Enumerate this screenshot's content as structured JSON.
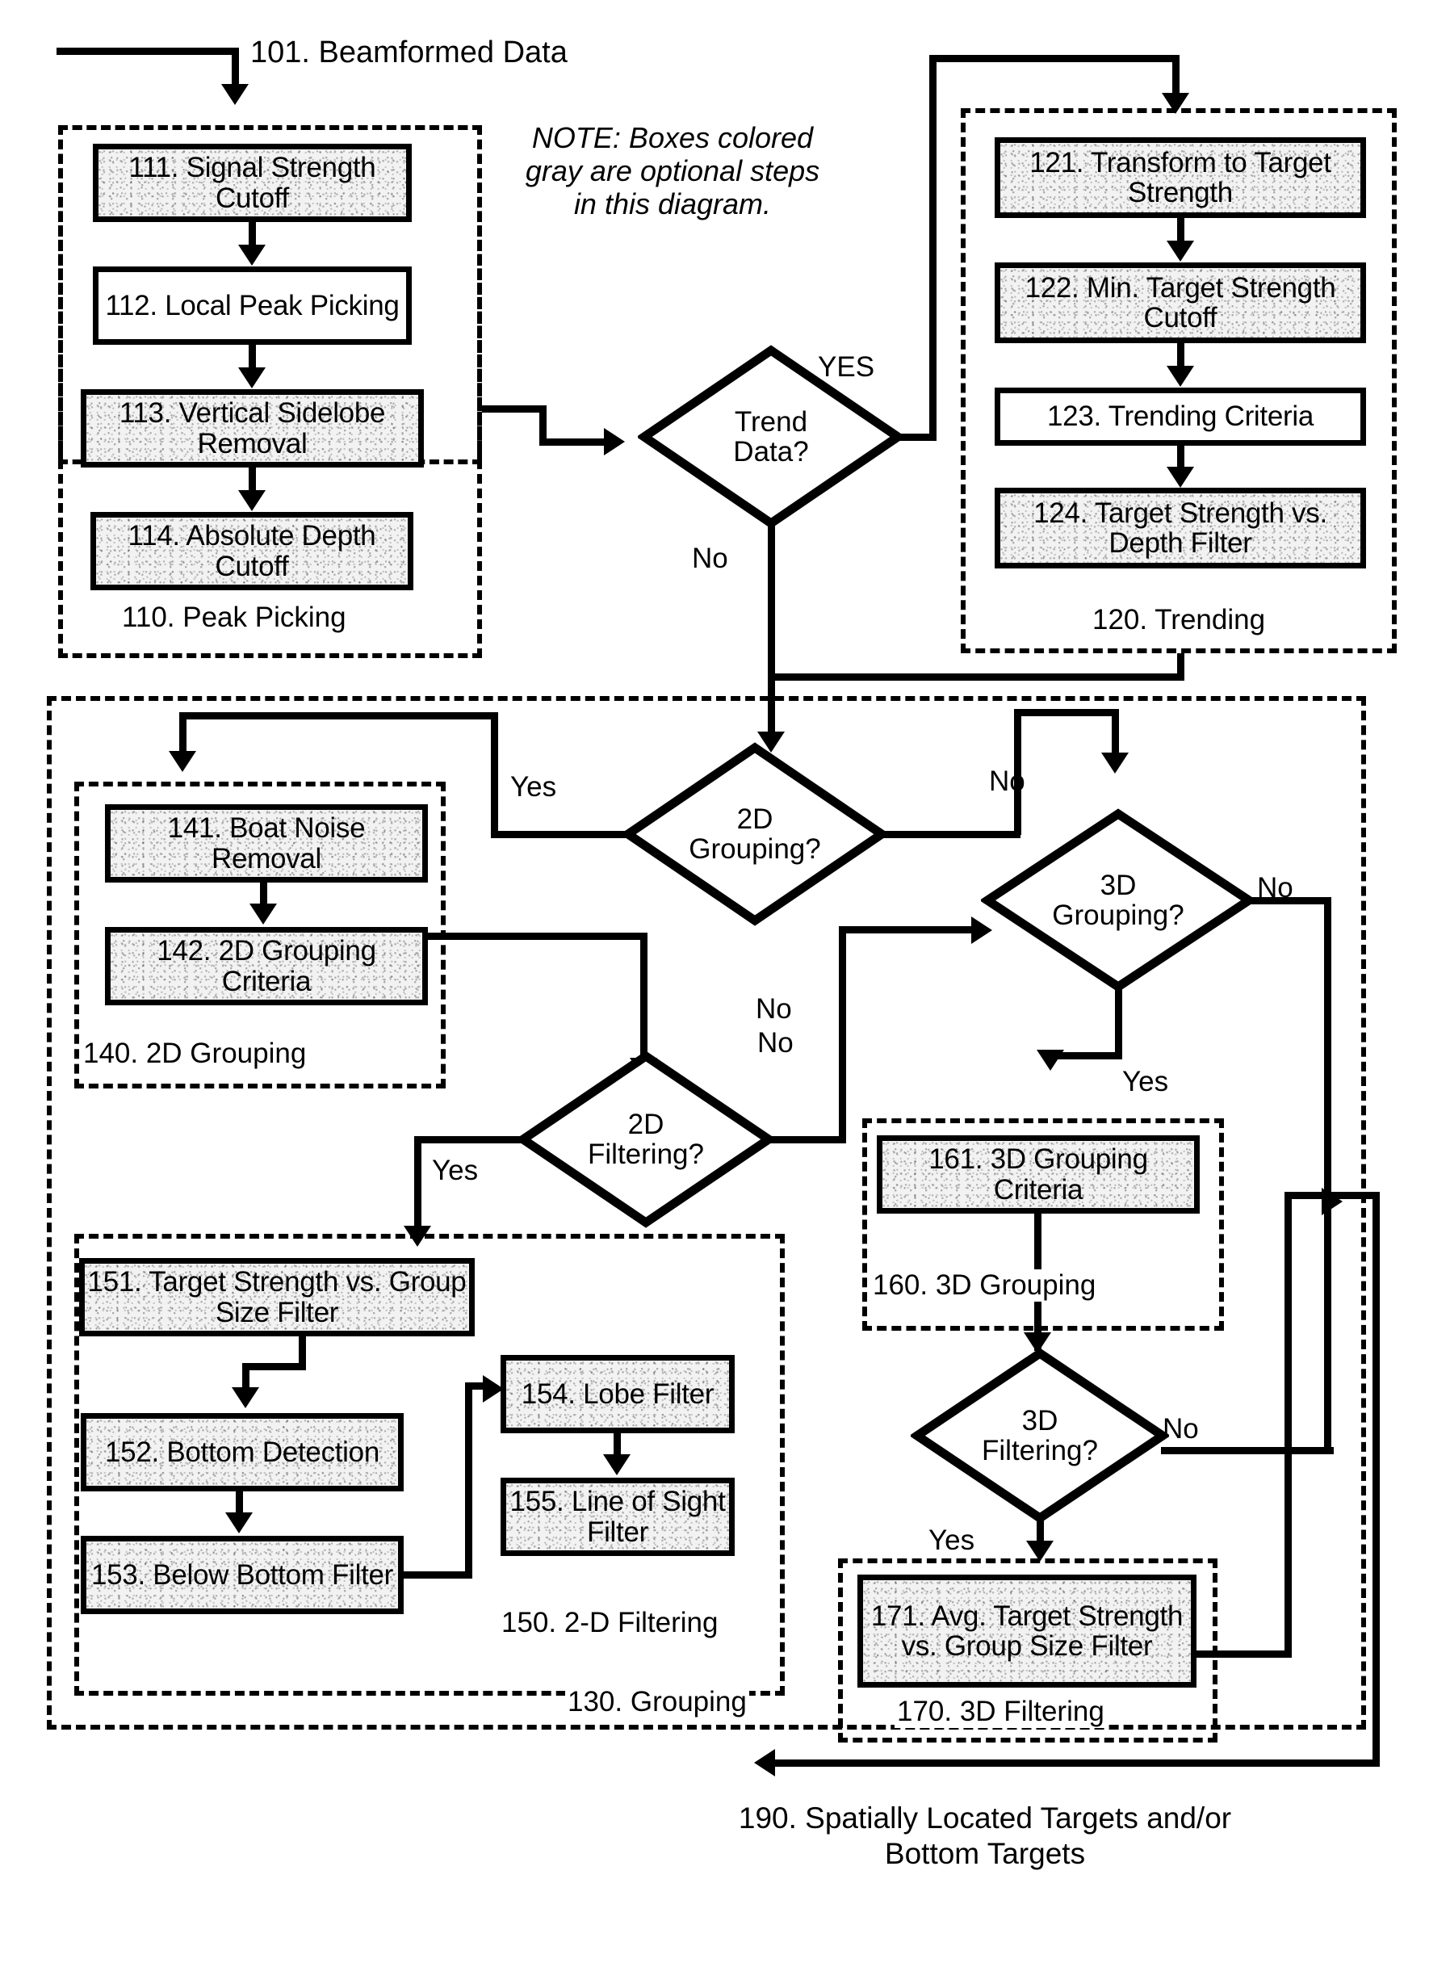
{
  "diagram": {
    "title_input": "101. Beamformed Data",
    "note": "NOTE: Boxes colored gray are optional steps in this diagram.",
    "output": "190. Spatially Located Targets and/or Bottom Targets"
  },
  "groups": {
    "peak_picking": "110. Peak Picking",
    "trending": "120. Trending",
    "grouping": "130. Grouping",
    "grouping_2d": "140. 2D Grouping",
    "filtering_2d": "150. 2-D Filtering",
    "grouping_3d": "160. 3D Grouping",
    "filtering_3d": "170. 3D Filtering"
  },
  "boxes": {
    "b111": "111. Signal Strength Cutoff",
    "b112": "112. Local Peak Picking",
    "b113": "113. Vertical Sidelobe Removal",
    "b114": "114. Absolute Depth Cutoff",
    "b121": "121. Transform to Target Strength",
    "b122": "122. Min. Target Strength Cutoff",
    "b123": "123. Trending Criteria",
    "b124": "124. Target Strength vs. Depth Filter",
    "b141": "141. Boat Noise Removal",
    "b142": "142. 2D Grouping Criteria",
    "b151": "151. Target Strength vs. Group Size Filter",
    "b152": "152. Bottom Detection",
    "b153": "153. Below Bottom Filter",
    "b154": "154. Lobe Filter",
    "b155": "155. Line of Sight Filter",
    "b161": "161. 3D Grouping Criteria",
    "b171": "171. Avg. Target Strength vs. Group Size Filter"
  },
  "decisions": {
    "trend_data": "Trend Data?",
    "grouping_2d": "2D Grouping?",
    "grouping_3d": "3D Grouping?",
    "filtering_2d": "2D Filtering?",
    "filtering_3d": "3D Filtering?"
  },
  "edge_labels": {
    "trend_yes": "YES",
    "trend_no": "No",
    "g2d_yes": "Yes",
    "g2d_no": "No",
    "g3d_no_in": "No",
    "g3d_no_out": "No",
    "g3d_yes": "Yes",
    "f2d_yes": "Yes",
    "f2d_no": "No",
    "f3d_no": "No",
    "f3d_yes": "Yes"
  },
  "optional_box_ids": [
    "b111",
    "b114",
    "b121",
    "b122",
    "b124",
    "b141",
    "b142",
    "b151",
    "b152",
    "b153",
    "b154",
    "b155",
    "b161",
    "b171"
  ],
  "colors": {
    "stroke": "#000000",
    "optional_fill": "#f2f2f2",
    "background": "#ffffff"
  }
}
